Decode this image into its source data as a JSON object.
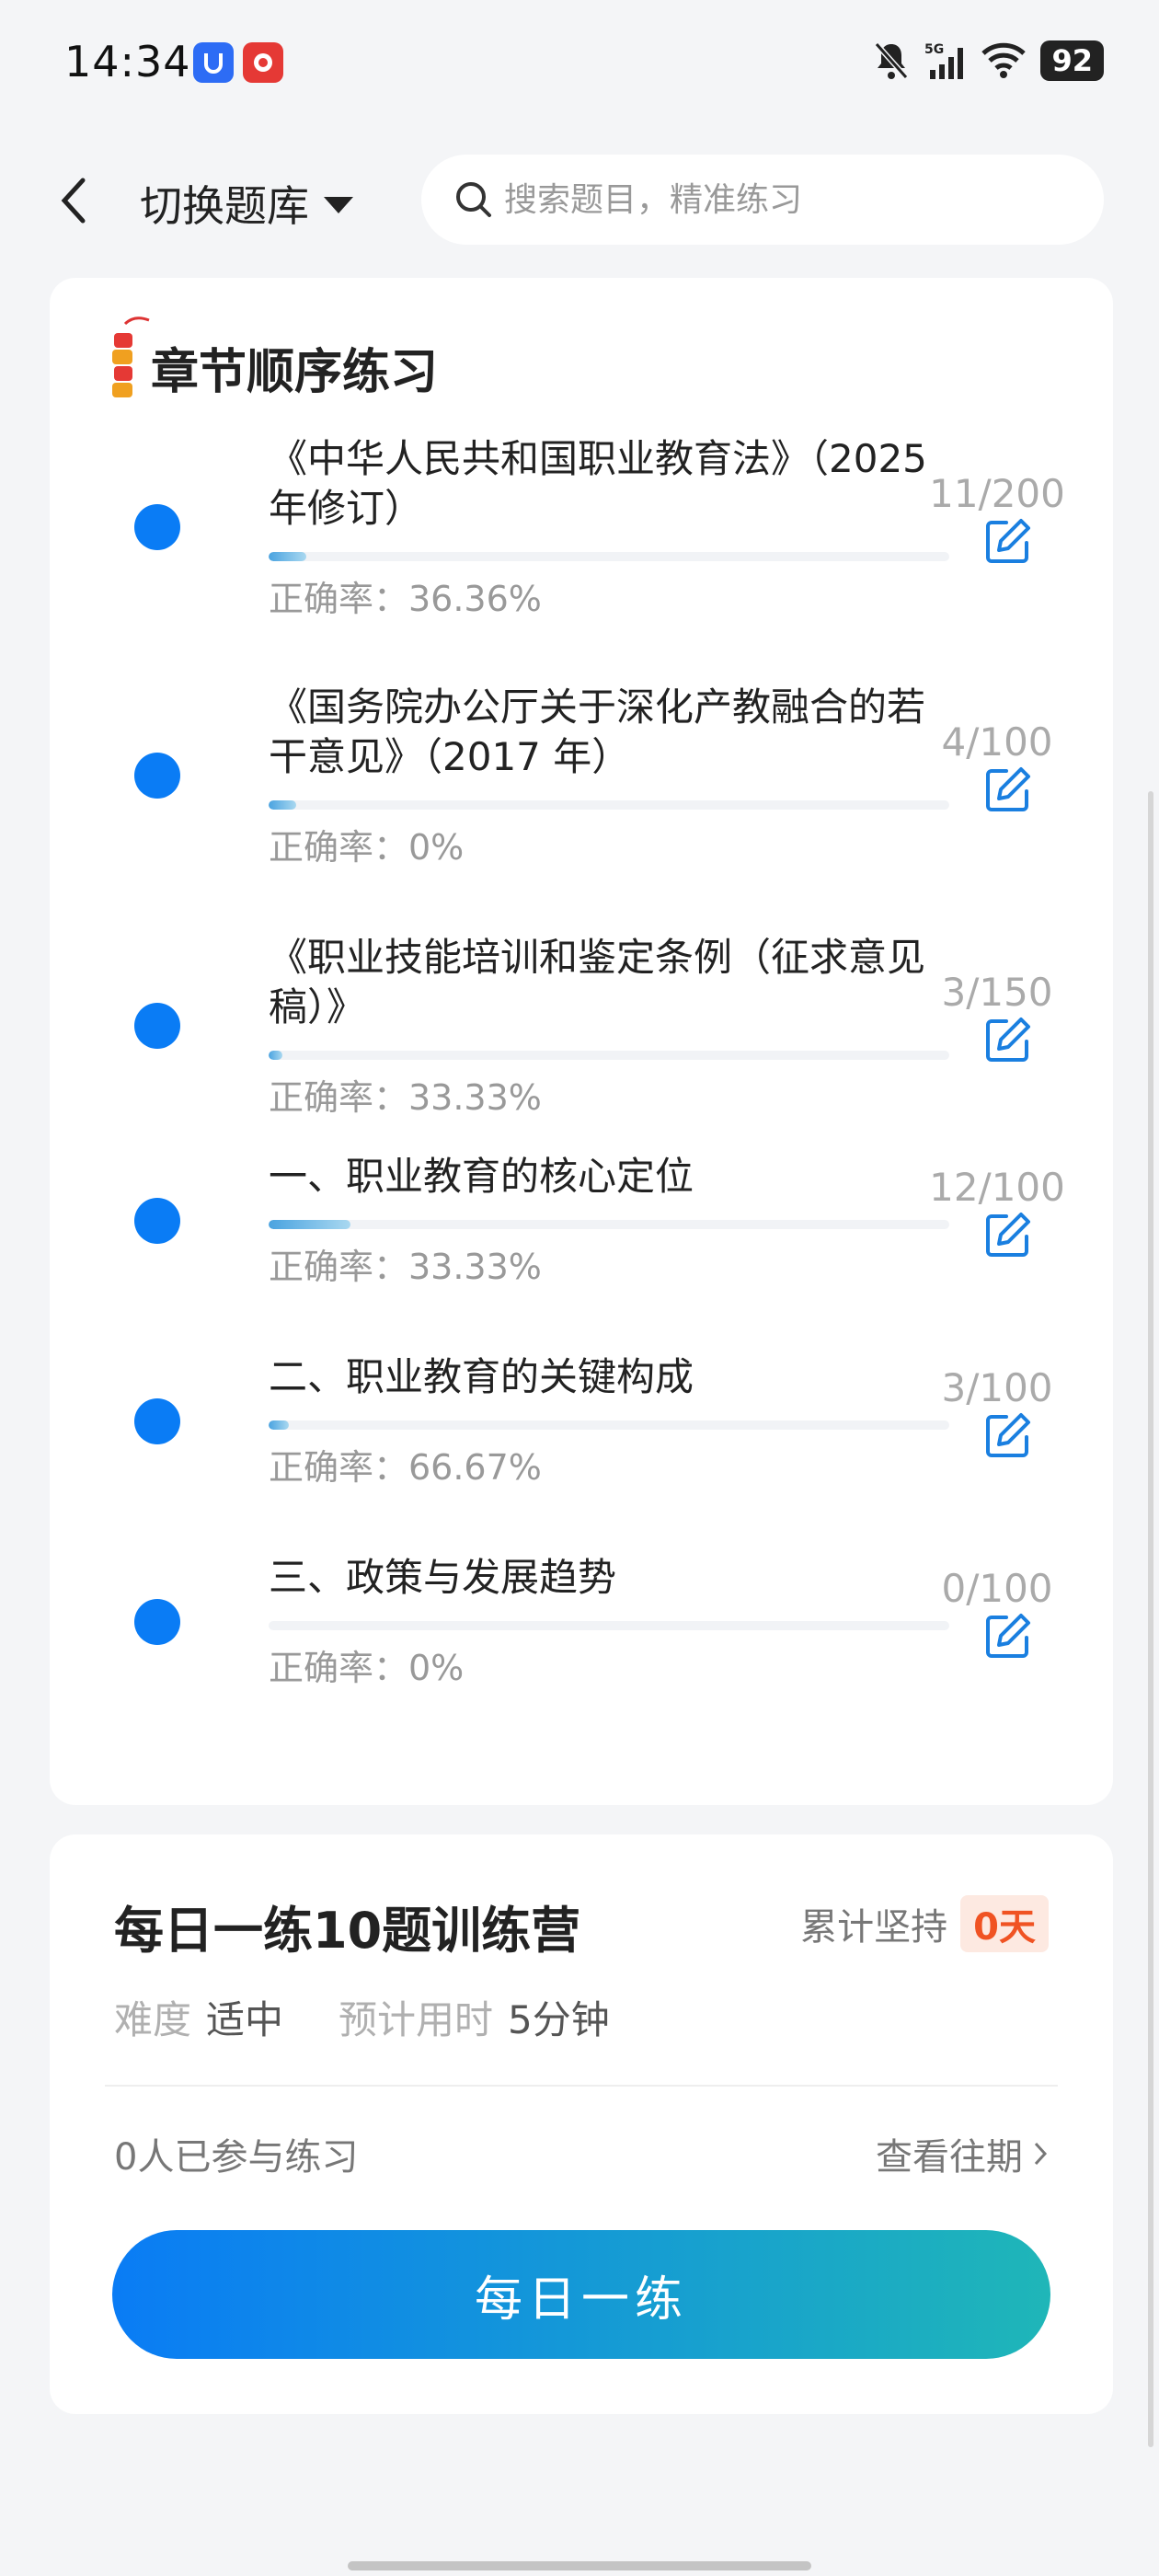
{
  "status_bar": {
    "time": "14:34",
    "battery": "92",
    "network": "5G"
  },
  "header": {
    "back_icon": "chevron-left-icon",
    "switch_label": "切换题库",
    "search_placeholder": "搜索题目，精准练习"
  },
  "chapters": {
    "title": "章节顺序练习",
    "items": [
      {
        "title": "《中华人民共和国职业教育法》（2025 年修订）",
        "progress": "11/200",
        "accuracy": "正确率：36.36%",
        "fraction": 0.055
      },
      {
        "title": "《国务院办公厅关于深化产教融合的若干意见》（2017 年）",
        "progress": "4/100",
        "accuracy": "正确率：0%",
        "fraction": 0.04
      },
      {
        "title": "《职业技能培训和鉴定条例（征求意见稿）》",
        "progress": "3/150",
        "accuracy": "正确率：33.33%",
        "fraction": 0.02
      },
      {
        "title": "一、职业教育的核心定位",
        "progress": "12/100",
        "accuracy": "正确率：33.33%",
        "fraction": 0.12
      },
      {
        "title": "二、职业教育的关键构成",
        "progress": "3/100",
        "accuracy": "正确率：66.67%",
        "fraction": 0.03
      },
      {
        "title": "三、政策与发展趋势",
        "progress": "0/100",
        "accuracy": "正确率：0%",
        "fraction": 0.0
      }
    ]
  },
  "daily": {
    "title": "每日一练10题训练营",
    "persist_label": "累计坚持",
    "persist_days": "0天",
    "difficulty_label": "难度",
    "difficulty_value": "适中",
    "time_label": "预计用时",
    "time_value": "5分钟",
    "participants": "0人已参与练习",
    "history_link": "查看往期",
    "cta": "每日一练"
  },
  "colors": {
    "accent": "#0a7cf5",
    "cta_end": "#1fb6b8",
    "persist": "#f05323"
  }
}
